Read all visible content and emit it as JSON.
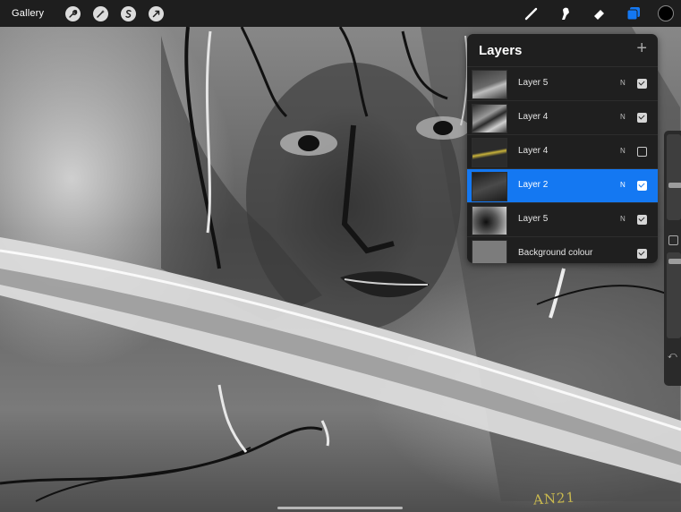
{
  "app": {
    "gallery_label": "Gallery",
    "tools_left": [
      {
        "icon": "wrench-icon",
        "name": "actions"
      },
      {
        "icon": "magic-wand-icon",
        "name": "adjustments"
      },
      {
        "icon": "selection-s-icon",
        "name": "selection"
      },
      {
        "icon": "transform-arrow-icon",
        "name": "transform"
      }
    ],
    "tools_right": [
      {
        "icon": "brush-icon",
        "name": "paint"
      },
      {
        "icon": "smudge-icon",
        "name": "smudge"
      },
      {
        "icon": "eraser-icon",
        "name": "erase"
      },
      {
        "icon": "layers-icon",
        "name": "layers",
        "active": true
      }
    ],
    "current_color": "#000000",
    "accent_color": "#1478f2"
  },
  "layers_panel": {
    "title": "Layers",
    "add_label": "+",
    "layers": [
      {
        "name": "Layer 5",
        "blend": "N",
        "visible": true,
        "selected": false
      },
      {
        "name": "Layer 4",
        "blend": "N",
        "visible": true,
        "selected": false
      },
      {
        "name": "Layer 4",
        "blend": "N",
        "visible": false,
        "selected": false
      },
      {
        "name": "Layer 2",
        "blend": "N",
        "visible": true,
        "selected": true
      },
      {
        "name": "Layer 5",
        "blend": "N",
        "visible": true,
        "selected": false
      },
      {
        "name": "Background colour",
        "blend": "",
        "visible": true,
        "selected": false
      }
    ]
  },
  "artwork": {
    "signature": "AN21"
  }
}
